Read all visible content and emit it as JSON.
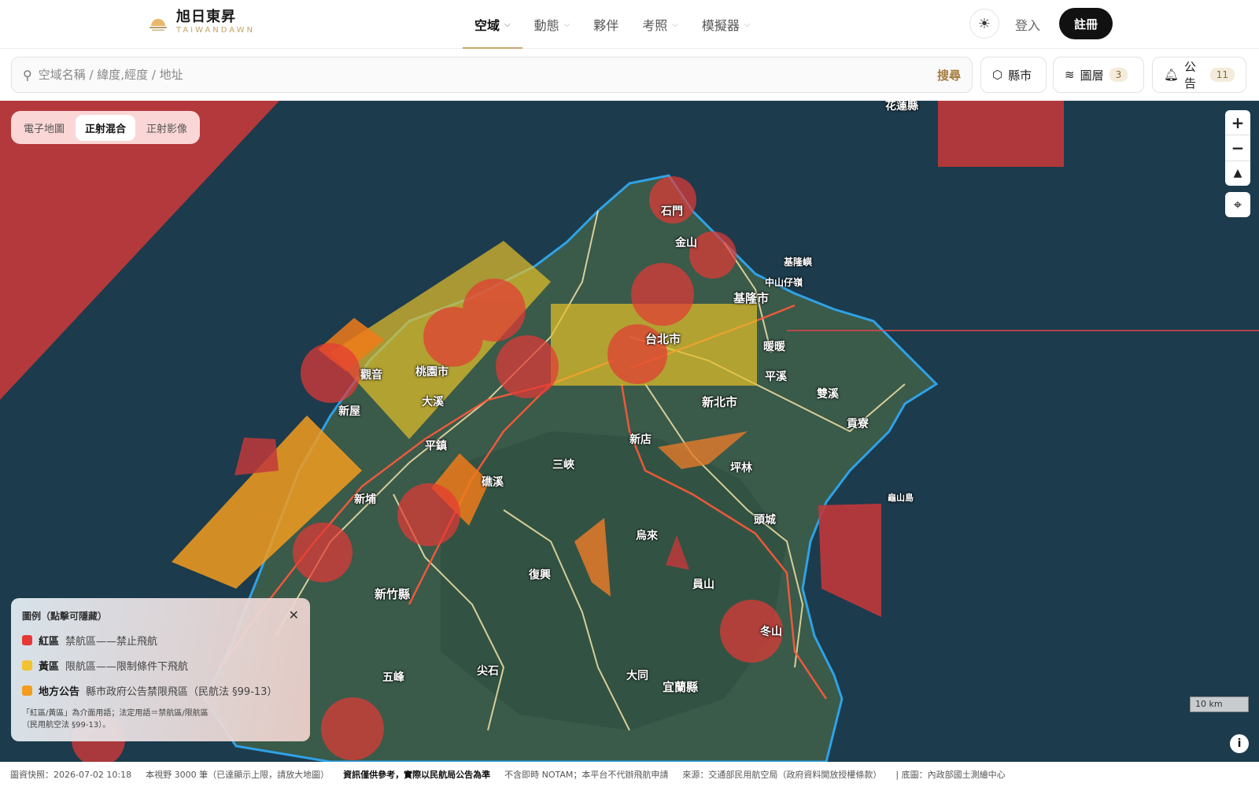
{
  "header": {
    "logo_title": "旭日東昇",
    "logo_subtitle": "TAIWANDAWN",
    "nav": [
      {
        "label": "空域",
        "dropdown": true,
        "active": true
      },
      {
        "label": "動態",
        "dropdown": true,
        "active": false
      },
      {
        "label": "夥伴",
        "dropdown": false,
        "active": false
      },
      {
        "label": "考照",
        "dropdown": true,
        "active": false
      },
      {
        "label": "模擬器",
        "dropdown": true,
        "active": false
      }
    ],
    "theme_icon": "sun-icon",
    "login_label": "登入",
    "register_label": "註冊"
  },
  "toolbar": {
    "search_placeholder": "空域名稱 / 緯度,經度 / 地址",
    "search_button": "搜尋",
    "county_label": "縣市",
    "layers_label": "圖層",
    "layers_count": "3",
    "notice_label": "公告",
    "notice_count": "11"
  },
  "map": {
    "basemap_options": [
      "電子地圖",
      "正射混合",
      "正射影像"
    ],
    "basemap_selected": "正射混合",
    "scale_label": "10 km",
    "place_labels": {
      "shimen": "石門",
      "jinshan": "金山",
      "keelung": "基隆市",
      "keelung_island": "基隆嶼",
      "zhongshan": "中山仔嶺",
      "xinbei_city": "新北市",
      "taipei": "台北市",
      "ruifang": "暖暖",
      "pingxi": "平溪",
      "shuangxi": "雙溪",
      "gongliao": "貢寮",
      "taoyuan": "桃園市",
      "guanyin": "觀音",
      "xinwu": "新屋",
      "xindian": "新店",
      "sanxia": "三峽",
      "pinglin": "坪林",
      "wulai": "烏來",
      "fuxing": "復興",
      "toucheng": "頭城",
      "jiaoxi": "礁溪",
      "yuanshan": "員山",
      "luodong": "冬山",
      "hsinchu_county": "新竹縣",
      "xinpu": "新埔",
      "wufeng": "五峰",
      "jianshi": "尖石",
      "datong": "大同",
      "yilan_county": "宜蘭縣",
      "hualien": "花蓮縣",
      "guishan": "龜山島",
      "daxi": "大溪",
      "pingzhen": "平鎮"
    }
  },
  "legend": {
    "title": "圖例（點擊可隱藏）",
    "items": [
      {
        "name": "紅區",
        "desc": "禁航區——禁止飛航",
        "color": "#e53935"
      },
      {
        "name": "黃區",
        "desc": "限航區——限制條件下飛航",
        "color": "#f2c230"
      },
      {
        "name": "地方公告",
        "desc": "縣市政府公告禁限飛區（民航法 §99-13）",
        "color": "#f39c1f"
      }
    ],
    "note": "「紅區/黃區」為介面用語；法定用語＝禁航區/限航區（民用航空法 §99-13）。"
  },
  "status": {
    "snapshot": "圖資快照：2026-07-02 10:18",
    "view_count": "本視野 3000 筆（已達顯示上限，請放大地圖）",
    "disclaimer": "資訊僅供參考，實際以民航局公告為準",
    "notam": "不含即時 NOTAM；本平台不代辦飛航申請",
    "source": "來源：交通部民用航空局（政府資料開放授權條款）",
    "basemap_src": "| 底圖：內政部國土測繪中心"
  }
}
